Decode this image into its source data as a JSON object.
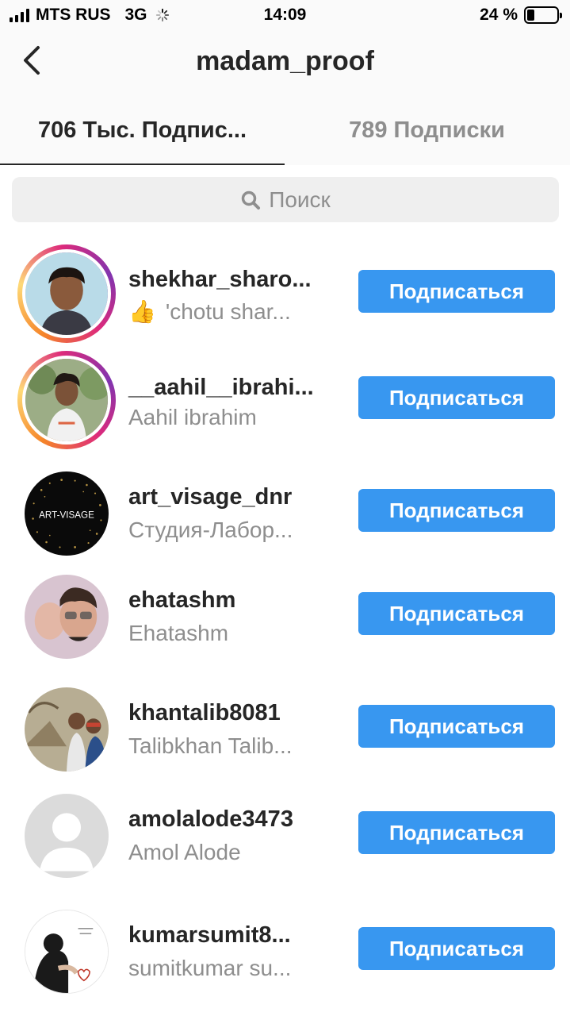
{
  "status_bar": {
    "carrier": "MTS RUS",
    "network": "3G",
    "time": "14:09",
    "battery_text": "24 %",
    "battery_level": 0.24
  },
  "header": {
    "title": "madam_proof",
    "back_icon": "chevron-left-icon"
  },
  "tabs": [
    {
      "label": "706 Тыс. Подпис...",
      "active": true
    },
    {
      "label": "789 Подписки",
      "active": false
    }
  ],
  "search": {
    "placeholder": "Поиск",
    "icon": "search-icon"
  },
  "follow_label": "Подписаться",
  "users": [
    {
      "username": "shekhar_sharo...",
      "full_name": "'chotu shar...",
      "emoji": "👍",
      "has_story": true
    },
    {
      "username": "__aahil__ibrahi...",
      "full_name": "Aahil ibrahim",
      "has_story": true
    },
    {
      "username": "art_visage_dnr",
      "full_name": "Студия-Лабор...",
      "has_story": false,
      "avatar_text": "ART-VISAGE"
    },
    {
      "username": "ehatashm",
      "full_name": "Ehatashm",
      "has_story": false
    },
    {
      "username": "khantalib8081",
      "full_name": "Talibkhan Talib...",
      "has_story": false
    },
    {
      "username": "amolalode3473",
      "full_name": "Amol Alode",
      "has_story": false
    },
    {
      "username": "kumarsumit8...",
      "full_name": "sumitkumar su...",
      "has_story": false
    }
  ],
  "colors": {
    "accent": "#3897f0",
    "text_primary": "#262626",
    "text_secondary": "#8e8e8e",
    "header_bg": "#fafafa"
  }
}
